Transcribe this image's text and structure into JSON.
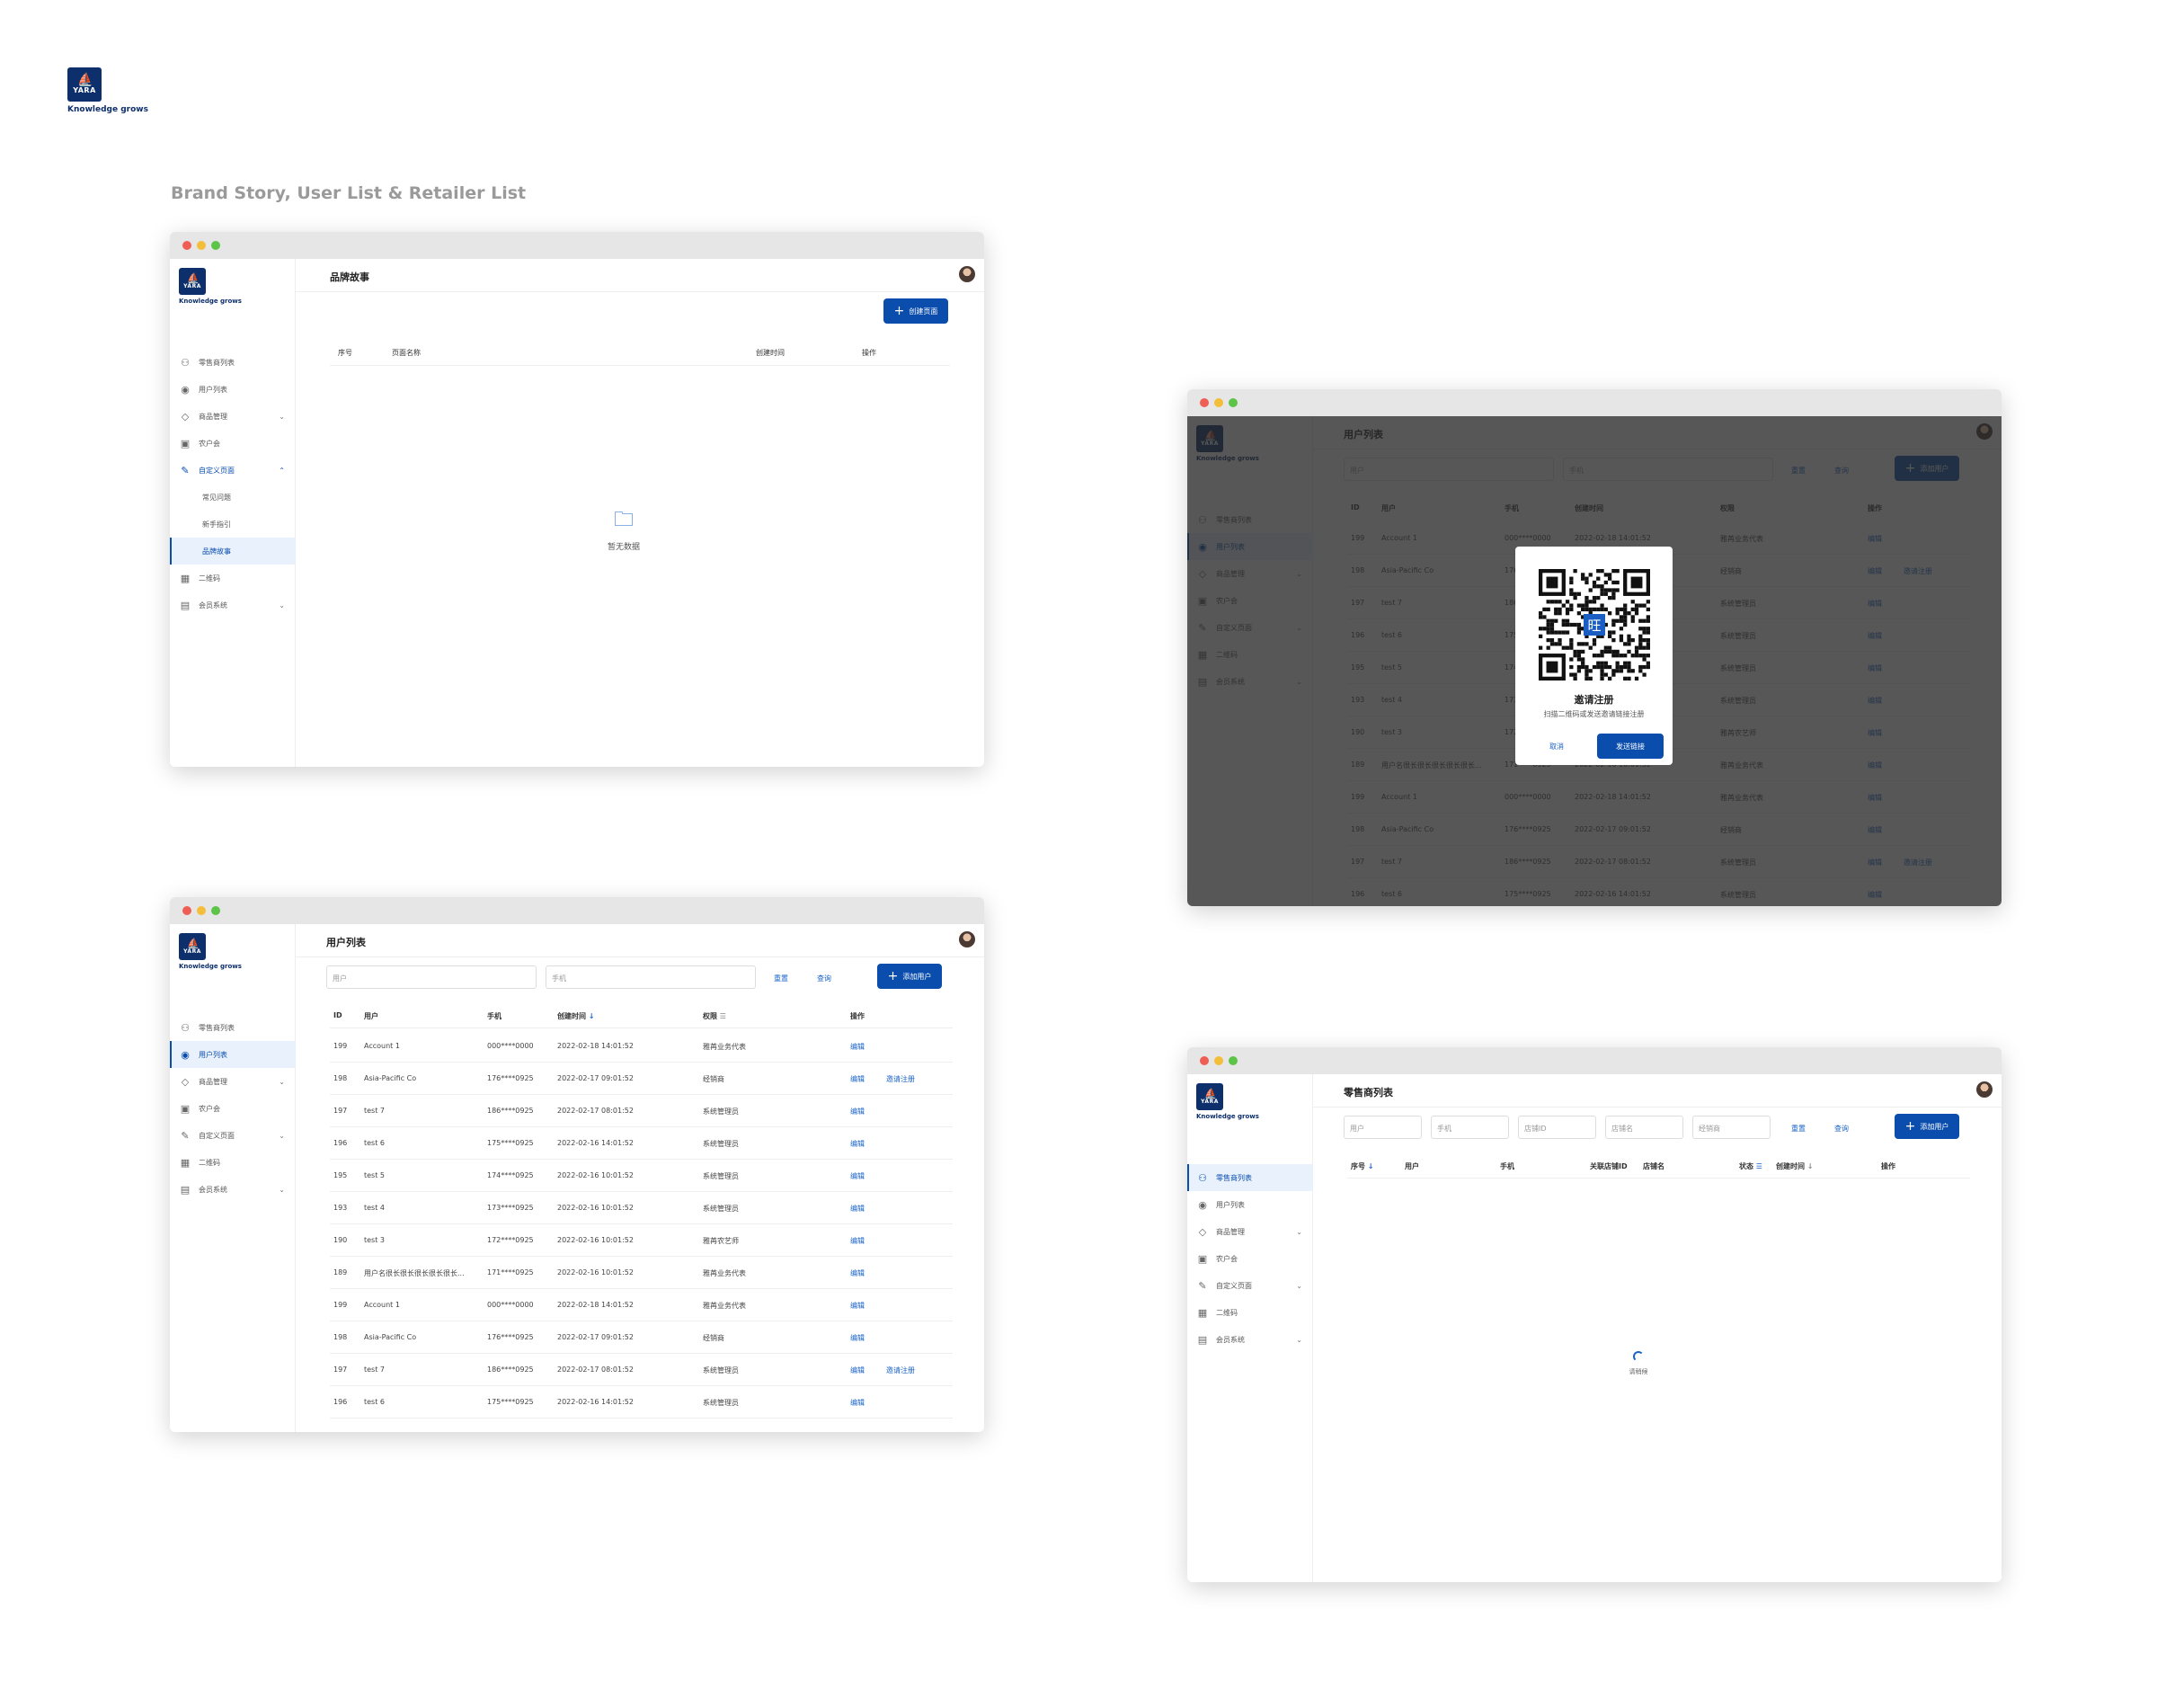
{
  "brand": {
    "word": "YARA",
    "tagline": "Knowledge grows"
  },
  "section_title": "Brand Story, User List & Retailer List",
  "sidebar": {
    "items": [
      "零售商列表",
      "用户列表",
      "商品管理",
      "农户会",
      "自定义页面",
      "二维码",
      "会员系统"
    ],
    "sub_items": [
      "常见问题",
      "新手指引",
      "品牌故事"
    ]
  },
  "brand_story": {
    "title": "品牌故事",
    "create_button": "创建页面",
    "columns": [
      "序号",
      "页面名称",
      "创建时间",
      "操作"
    ],
    "empty_text": "暂无数据"
  },
  "user_list": {
    "title": "用户列表",
    "user_placeholder": "用户",
    "phone_placeholder": "手机",
    "reset": "重置",
    "query": "查询",
    "add_button": "添加用户",
    "columns": [
      "ID",
      "用户",
      "手机",
      "创建时间",
      "权限",
      "操作"
    ],
    "rows": [
      {
        "id": "199",
        "user": "Account 1",
        "phone": "000****0000",
        "created": "2022-02-18 14:01:52",
        "role": "雅苒业务代表",
        "ops": [
          "编辑"
        ]
      },
      {
        "id": "198",
        "user": "Asia-Pacific Co",
        "phone": "176****0925",
        "created": "2022-02-17 09:01:52",
        "role": "经销商",
        "ops": [
          "编辑",
          "邀请注册"
        ]
      },
      {
        "id": "197",
        "user": "test 7",
        "phone": "186****0925",
        "created": "2022-02-17 08:01:52",
        "role": "系统管理员",
        "ops": [
          "编辑"
        ]
      },
      {
        "id": "196",
        "user": "test 6",
        "phone": "175****0925",
        "created": "2022-02-16 14:01:52",
        "role": "系统管理员",
        "ops": [
          "编辑"
        ]
      },
      {
        "id": "195",
        "user": "test 5",
        "phone": "174****0925",
        "created": "2022-02-16 10:01:52",
        "role": "系统管理员",
        "ops": [
          "编辑"
        ]
      },
      {
        "id": "193",
        "user": "test 4",
        "phone": "173****0925",
        "created": "2022-02-16 10:01:52",
        "role": "系统管理员",
        "ops": [
          "编辑"
        ]
      },
      {
        "id": "190",
        "user": "test 3",
        "phone": "172****0925",
        "created": "2022-02-16 10:01:52",
        "role": "雅苒农艺师",
        "ops": [
          "编辑"
        ]
      },
      {
        "id": "189",
        "user": "用户名很长很长很长很长很长...",
        "phone": "171****0925",
        "created": "2022-02-16 10:01:52",
        "role": "雅苒业务代表",
        "ops": [
          "编辑"
        ]
      },
      {
        "id": "199",
        "user": "Account 1",
        "phone": "000****0000",
        "created": "2022-02-18 14:01:52",
        "role": "雅苒业务代表",
        "ops": [
          "编辑"
        ]
      },
      {
        "id": "198",
        "user": "Asia-Pacific Co",
        "phone": "176****0925",
        "created": "2022-02-17 09:01:52",
        "role": "经销商",
        "ops": [
          "编辑"
        ]
      },
      {
        "id": "197",
        "user": "test 7",
        "phone": "186****0925",
        "created": "2022-02-17 08:01:52",
        "role": "系统管理员",
        "ops": [
          "编辑",
          "邀请注册"
        ]
      },
      {
        "id": "196",
        "user": "test 6",
        "phone": "175****0925",
        "created": "2022-02-16 14:01:52",
        "role": "系统管理员",
        "ops": [
          "编辑"
        ]
      }
    ]
  },
  "invite_modal": {
    "qr_char": "旺",
    "title": "邀请注册",
    "subtitle": "扫描二维码或发送邀请链接注册",
    "cancel": "取消",
    "send": "发送链接"
  },
  "retailer_list": {
    "title": "零售商列表",
    "filters": [
      "用户",
      "手机",
      "店铺ID",
      "店铺名",
      "经销商"
    ],
    "reset": "重置",
    "query": "查询",
    "add_button": "添加用户",
    "columns": [
      "序号",
      "用户",
      "手机",
      "关联店铺ID",
      "店铺名",
      "状态",
      "创建时间",
      "操作"
    ],
    "loading_text": "请稍候"
  },
  "colors": {
    "primary": "#0a4dad",
    "navy": "#0d2f6b"
  }
}
